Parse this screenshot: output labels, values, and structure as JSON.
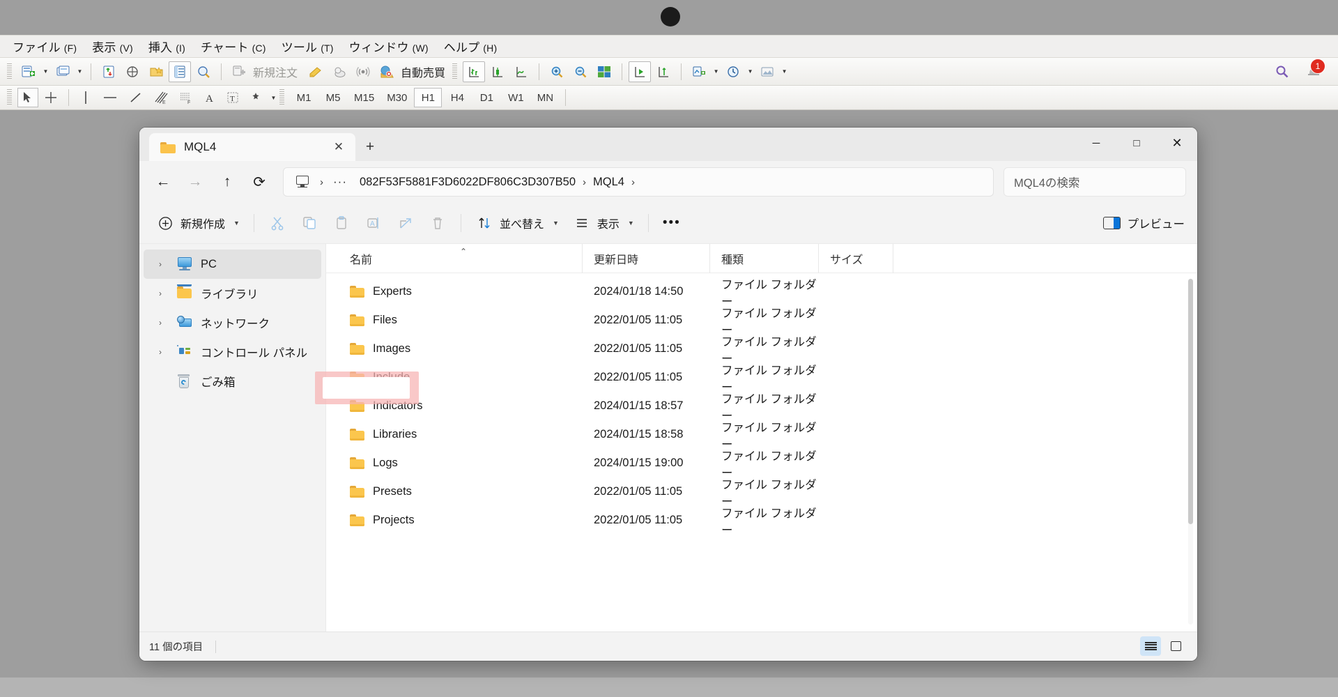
{
  "mt4": {
    "menu": [
      {
        "label": "ファイル",
        "accel": "(F)"
      },
      {
        "label": "表示",
        "accel": "(V)"
      },
      {
        "label": "挿入",
        "accel": "(I)"
      },
      {
        "label": "チャート",
        "accel": "(C)"
      },
      {
        "label": "ツール",
        "accel": "(T)"
      },
      {
        "label": "ウィンドウ",
        "accel": "(W)"
      },
      {
        "label": "ヘルプ",
        "accel": "(H)"
      }
    ],
    "toolbar_main": {
      "new_chart_icon": "new-chart-icon",
      "profiles_icon": "profiles-icon",
      "market_watch_icon": "market-watch-icon",
      "data_window_icon": "data-window-icon",
      "navigator_icon": "navigator-icon",
      "terminal_icon": "terminal-icon",
      "strategy_tester_icon": "strategy-tester-icon",
      "new_order_label": "新規注文",
      "metaeditor_icon": "metaeditor-icon",
      "expert_icon": "expert-icon",
      "signals_icon": "signals-icon",
      "autotrading_label": "自動売買",
      "bar_chart_icon": "bar-chart-icon",
      "candle_chart_icon": "candlestick-chart-icon",
      "line_chart_icon": "line-chart-icon",
      "zoom_in_icon": "zoom-in-icon",
      "zoom_out_icon": "zoom-out-icon",
      "tile_windows_icon": "tile-windows-icon",
      "auto_scroll_icon": "auto-scroll-icon",
      "chart_shift_icon": "chart-shift-icon",
      "indicators_icon": "indicators-icon",
      "period_icon": "period-icon",
      "templates_icon": "templates-icon",
      "search_icon": "search-icon",
      "alert_icon": "alert-icon",
      "alert_badge": "1"
    },
    "toolbar_line": {
      "cursor_icon": "cursor-icon",
      "crosshair_icon": "crosshair-icon",
      "vertical_line_icon": "vertical-line-icon",
      "horizontal_line_icon": "horizontal-line-icon",
      "trendline_icon": "trendline-icon",
      "equidistant_channel_icon": "equidistant-channel-icon",
      "fibonacci_icon": "fibonacci-retracement-icon",
      "text_icon": "text-icon",
      "text_label_icon": "text-label-icon",
      "shapes_icon": "shapes-icon"
    },
    "timeframes": [
      "M1",
      "M5",
      "M15",
      "M30",
      "H1",
      "H4",
      "D1",
      "W1",
      "MN"
    ],
    "timeframe_selected": "H1"
  },
  "explorer": {
    "tab": {
      "title": "MQL4",
      "close_label": "✕",
      "new_tab_label": "+"
    },
    "window_controls": {
      "minimize": "─",
      "maximize": "□",
      "close": "✕"
    },
    "nav": {
      "back": "←",
      "forward": "→",
      "up": "↑",
      "refresh": "⟳"
    },
    "address": {
      "pc_icon": "this-pc-icon",
      "overflow": "···",
      "crumbs": [
        "082F53F5881F3D6022DF806C3D307B50",
        "MQL4"
      ],
      "separator": "›"
    },
    "search": {
      "placeholder": "MQL4の検索"
    },
    "commandbar": {
      "new_label": "新規作成",
      "cut_icon": "cut-icon",
      "copy_icon": "copy-icon",
      "paste_icon": "paste-icon",
      "rename_icon": "rename-icon",
      "share_icon": "share-icon",
      "delete_icon": "delete-icon",
      "sort_label": "並べ替え",
      "view_label": "表示",
      "more_label": "•••",
      "preview_label": "プレビュー"
    },
    "sidebar": {
      "items": [
        {
          "label": "PC",
          "icon": "this-pc-icon",
          "expandable": true,
          "selected": true
        },
        {
          "label": "ライブラリ",
          "icon": "library-folder-icon",
          "expandable": true,
          "selected": false
        },
        {
          "label": "ネットワーク",
          "icon": "network-icon",
          "expandable": true,
          "selected": false
        },
        {
          "label": "コントロール パネル",
          "icon": "control-panel-icon",
          "expandable": true,
          "selected": false
        },
        {
          "label": "ごみ箱",
          "icon": "recycle-bin-icon",
          "expandable": false,
          "selected": false
        }
      ]
    },
    "columns": [
      {
        "key": "name",
        "label": "名前"
      },
      {
        "key": "date",
        "label": "更新日時"
      },
      {
        "key": "type",
        "label": "種類"
      },
      {
        "key": "size",
        "label": "サイズ"
      }
    ],
    "sort": {
      "column": "名前",
      "direction": "asc",
      "caret": "⌃"
    },
    "files": [
      {
        "name": "Experts",
        "date": "2024/01/18 14:50",
        "type": "ファイル フォルダー",
        "size": "",
        "icon": "folder-icon",
        "highlighted": false
      },
      {
        "name": "Files",
        "date": "2022/01/05 11:05",
        "type": "ファイル フォルダー",
        "size": "",
        "icon": "folder-icon",
        "highlighted": false
      },
      {
        "name": "Images",
        "date": "2022/01/05 11:05",
        "type": "ファイル フォルダー",
        "size": "",
        "icon": "folder-icon",
        "highlighted": false
      },
      {
        "name": "Include",
        "date": "2022/01/05 11:05",
        "type": "ファイル フォルダー",
        "size": "",
        "icon": "folder-icon",
        "highlighted": false
      },
      {
        "name": "Indicators",
        "date": "2024/01/15 18:57",
        "type": "ファイル フォルダー",
        "size": "",
        "icon": "folder-icon",
        "highlighted": true
      },
      {
        "name": "Libraries",
        "date": "2024/01/15 18:58",
        "type": "ファイル フォルダー",
        "size": "",
        "icon": "folder-icon",
        "highlighted": false
      },
      {
        "name": "Logs",
        "date": "2024/01/15 19:00",
        "type": "ファイル フォルダー",
        "size": "",
        "icon": "folder-icon",
        "highlighted": false
      },
      {
        "name": "Presets",
        "date": "2022/01/05 11:05",
        "type": "ファイル フォルダー",
        "size": "",
        "icon": "folder-icon",
        "highlighted": false
      },
      {
        "name": "Projects",
        "date": "2022/01/05 11:05",
        "type": "ファイル フォルダー",
        "size": "",
        "icon": "folder-icon",
        "highlighted": false
      }
    ],
    "status": {
      "item_count": "11 個の項目",
      "details_view_icon": "details-view-icon",
      "large_icons_view_icon": "large-icons-view-icon"
    },
    "colors": {
      "highlight": "#f7b3b3",
      "folder": "#fbc64d",
      "accent": "#0a74d8",
      "selection": "#e2e2e2"
    }
  }
}
